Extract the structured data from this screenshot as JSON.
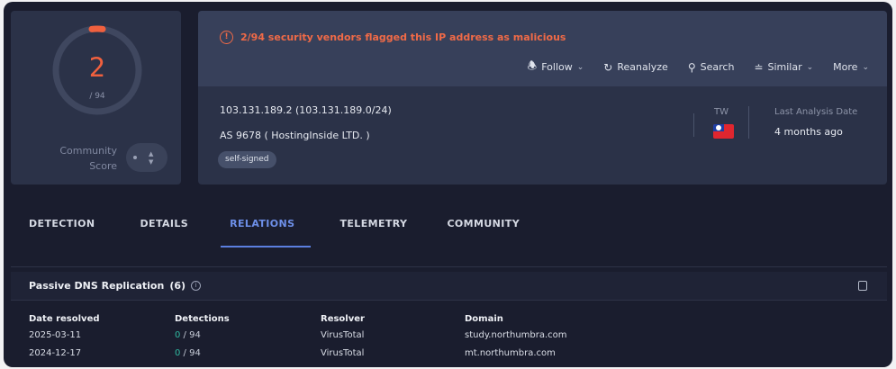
{
  "score": {
    "malicious": "2",
    "total": "/ 94",
    "community_label_line1": "Community",
    "community_label_line2": "Score"
  },
  "alert": {
    "icon": "alert-circle-icon",
    "text": "2/94 security vendors flagged this IP address as malicious",
    "color": "#f06a47"
  },
  "actions": [
    {
      "label": "Follow",
      "icon": "bell-icon",
      "dropdown": true
    },
    {
      "label": "Reanalyze",
      "icon": "refresh-icon",
      "dropdown": false
    },
    {
      "label": "Search",
      "icon": "search-icon",
      "dropdown": false
    },
    {
      "label": "Similar",
      "icon": "similar-icon",
      "dropdown": true
    },
    {
      "label": "More",
      "icon": "",
      "dropdown": true
    }
  ],
  "ip": {
    "address_line": "103.131.189.2  (103.131.189.0/24)",
    "as_line": "AS 9678  ( HostingInside LTD. )",
    "tag": "self-signed",
    "country_code": "TW",
    "last_analysis_label": "Last Analysis Date",
    "last_analysis_value": "4 months ago"
  },
  "tabs": [
    {
      "label": "DETECTION",
      "active": false
    },
    {
      "label": "DETAILS",
      "active": false
    },
    {
      "label": "RELATIONS",
      "active": true
    },
    {
      "label": "TELEMETRY",
      "active": false
    },
    {
      "label": "COMMUNITY",
      "active": false
    }
  ],
  "passive_dns": {
    "title": "Passive DNS Replication",
    "count": "(6)",
    "columns": [
      "Date resolved",
      "Detections",
      "Resolver",
      "Domain"
    ],
    "rows": [
      {
        "date": "2025-03-11",
        "detections_good": "0",
        "detections_total": " / 94",
        "resolver": "VirusTotal",
        "domain": "study.northumbra.com"
      },
      {
        "date": "2024-12-17",
        "detections_good": "0",
        "detections_total": " / 94",
        "resolver": "VirusTotal",
        "domain": "mt.northumbra.com"
      }
    ]
  },
  "colors": {
    "background": "#1a1d2e",
    "panel": "#2b3248",
    "accent": "#5b7fe0",
    "danger": "#f0603e",
    "success": "#2fb9a0"
  }
}
